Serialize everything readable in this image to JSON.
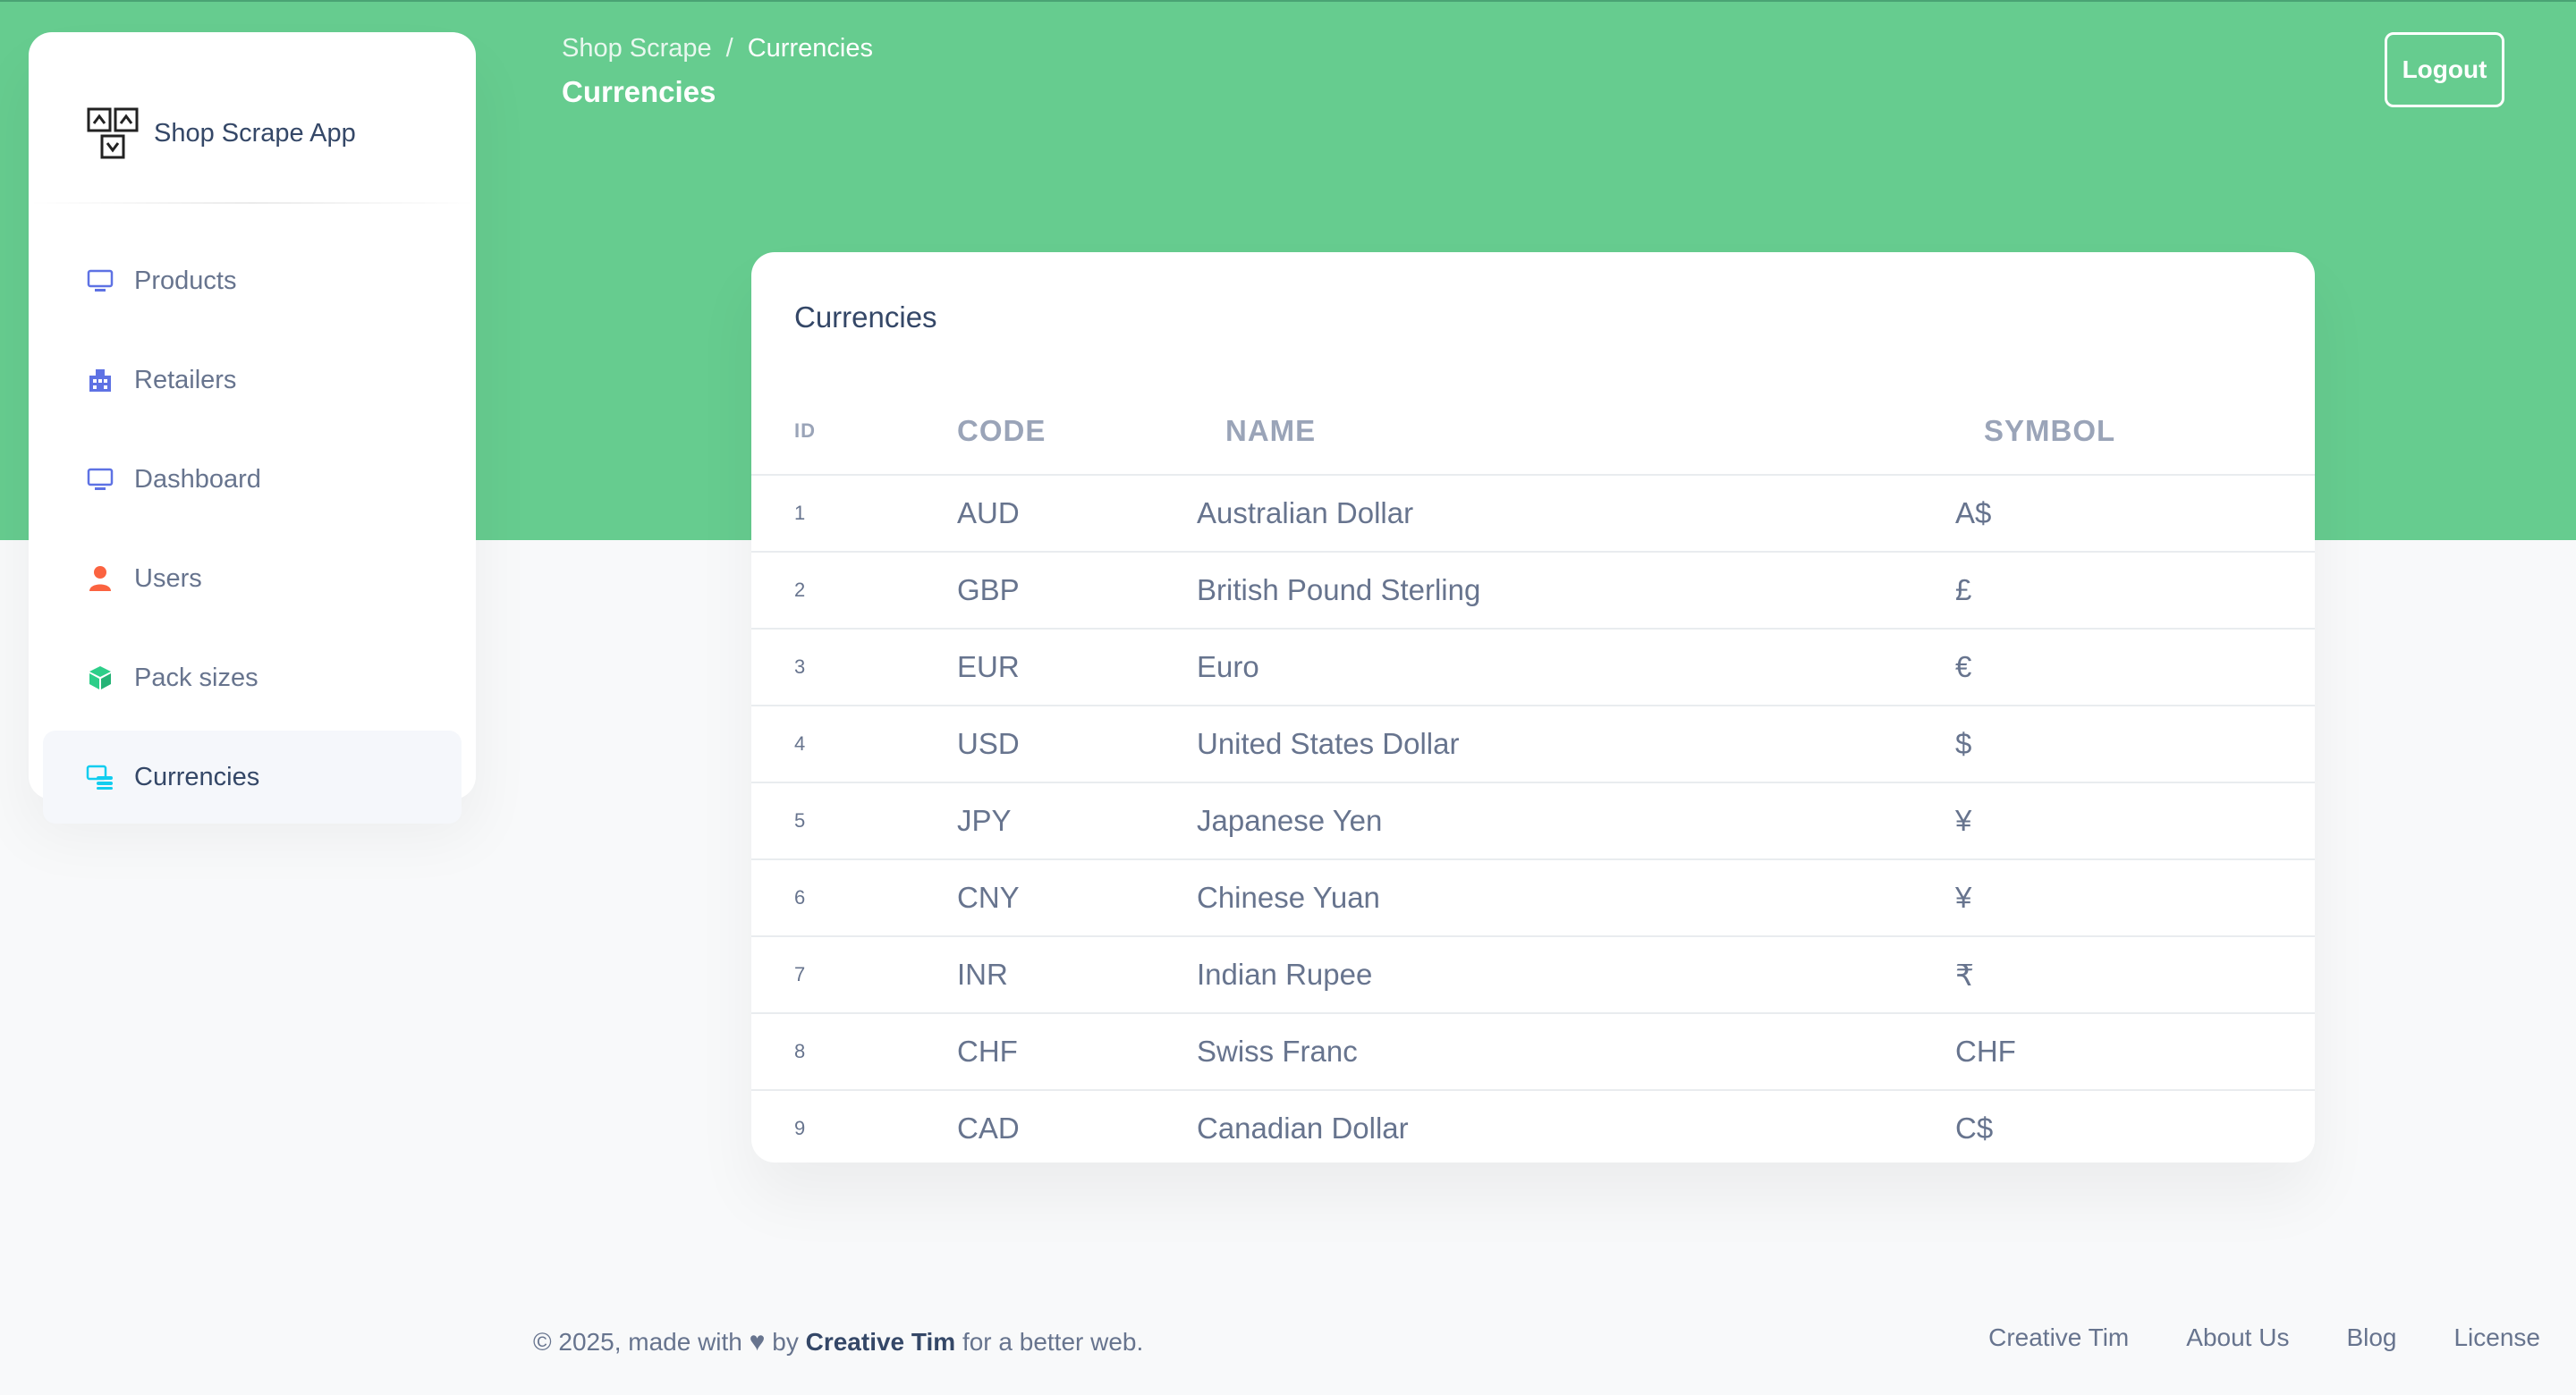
{
  "brand": {
    "name": "Shop Scrape App",
    "logo_icon": "boxes-logo-icon"
  },
  "sidebar": {
    "items": [
      {
        "label": "Products",
        "icon": "monitor-icon",
        "color": "#5e72e4"
      },
      {
        "label": "Retailers",
        "icon": "building-icon",
        "color": "#5e72e4"
      },
      {
        "label": "Dashboard",
        "icon": "monitor-icon",
        "color": "#5e72e4"
      },
      {
        "label": "Users",
        "icon": "user-icon",
        "color": "#fb6340"
      },
      {
        "label": "Pack sizes",
        "icon": "box-icon",
        "color": "#2dce89"
      },
      {
        "label": "Currencies",
        "icon": "coins-icon",
        "color": "#11cdef",
        "active": true
      }
    ]
  },
  "header": {
    "breadcrumb": [
      "Shop Scrape",
      "Currencies"
    ],
    "breadcrumb_separator": "/",
    "title": "Currencies",
    "logout_label": "Logout"
  },
  "card": {
    "title": "Currencies",
    "columns": [
      "ID",
      "CODE",
      "NAME",
      "SYMBOL"
    ],
    "rows": [
      {
        "id": "1",
        "code": "AUD",
        "name": "Australian Dollar",
        "symbol": "A$"
      },
      {
        "id": "2",
        "code": "GBP",
        "name": "British Pound Sterling",
        "symbol": "£"
      },
      {
        "id": "3",
        "code": "EUR",
        "name": "Euro",
        "symbol": "€"
      },
      {
        "id": "4",
        "code": "USD",
        "name": "United States Dollar",
        "symbol": "$"
      },
      {
        "id": "5",
        "code": "JPY",
        "name": "Japanese Yen",
        "symbol": "¥"
      },
      {
        "id": "6",
        "code": "CNY",
        "name": "Chinese Yuan",
        "symbol": "¥"
      },
      {
        "id": "7",
        "code": "INR",
        "name": "Indian Rupee",
        "symbol": "₹"
      },
      {
        "id": "8",
        "code": "CHF",
        "name": "Swiss Franc",
        "symbol": "CHF"
      },
      {
        "id": "9",
        "code": "CAD",
        "name": "Canadian Dollar",
        "symbol": "C$"
      }
    ]
  },
  "footer": {
    "copyright_prefix": "© 2025, made with",
    "by": "by",
    "author": "Creative Tim",
    "suffix": "for a better web.",
    "links": [
      "Creative Tim",
      "About Us",
      "Blog",
      "License"
    ]
  },
  "colors": {
    "hero": "#66cc8f",
    "text": "#67748e",
    "heading": "#344767"
  }
}
